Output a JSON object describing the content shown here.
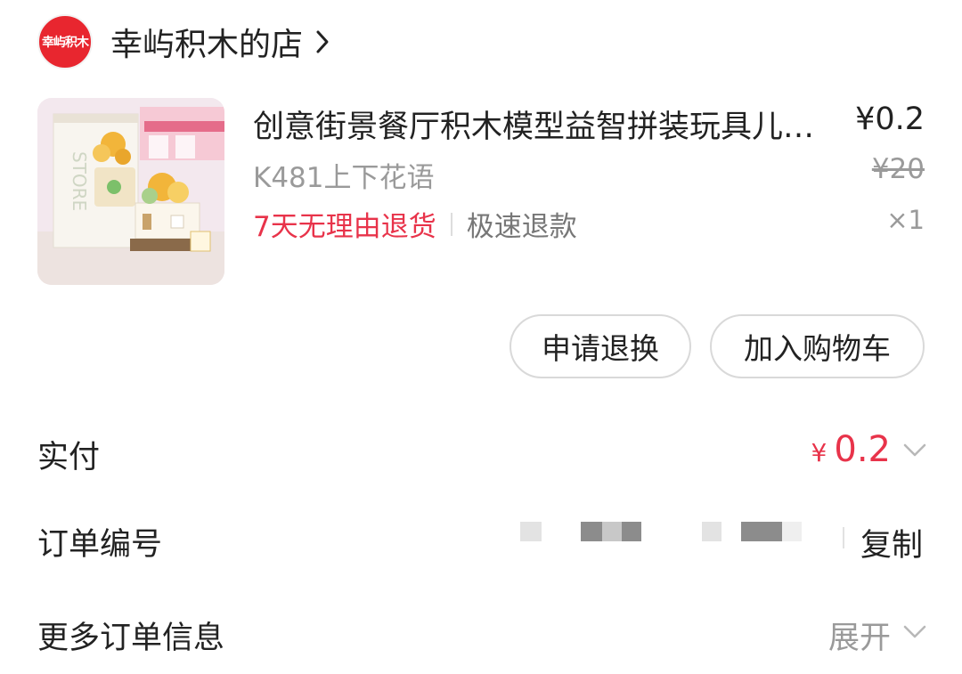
{
  "shop": {
    "logo_text": "幸屿积木",
    "name": "幸屿积木的店"
  },
  "product": {
    "title": "创意街景餐厅积木模型益智拼装玩具儿…",
    "price": "¥0.2",
    "variant": "K481上下花语",
    "original_price": "¥20",
    "tag_return": "7天无理由退货",
    "tag_refund": "极速退款",
    "quantity": "×1",
    "image_text": "STORE"
  },
  "actions": {
    "return_label": "申请退换",
    "cart_label": "加入购物车"
  },
  "details": {
    "paid_label": "实付",
    "paid_currency": "¥",
    "paid_amount": "0.2",
    "order_no_label": "订单编号",
    "copy_label": "复制",
    "more_label": "更多订单信息",
    "expand_label": "展开"
  },
  "colors": {
    "accent_red": "#e8334a",
    "logo_red": "#e8262f",
    "muted_gray": "#9a9a9a"
  }
}
